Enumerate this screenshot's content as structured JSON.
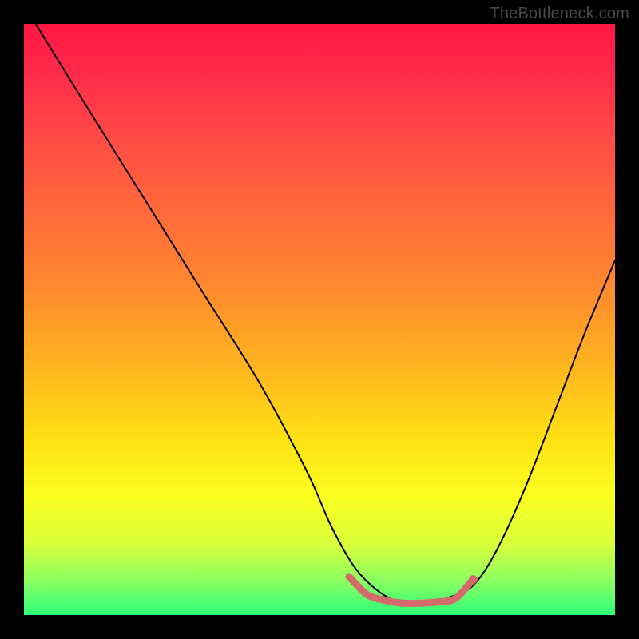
{
  "watermark": "TheBottleneck.com",
  "chart_data": {
    "type": "line",
    "title": "",
    "xlabel": "",
    "ylabel": "",
    "xlim": [
      0,
      100
    ],
    "ylim": [
      0,
      100
    ],
    "grid": false,
    "legend": false,
    "series": [
      {
        "name": "bottleneck-curve",
        "stroke": "#000000",
        "stroke_width": 2,
        "x": [
          2,
          10,
          20,
          30,
          40,
          48,
          52,
          56,
          60,
          64,
          68,
          72,
          76,
          80,
          85,
          90,
          95,
          100
        ],
        "y": [
          100,
          87,
          71,
          55,
          39,
          24,
          15,
          8,
          4,
          2,
          2,
          3,
          5,
          11,
          22,
          35,
          48,
          60
        ]
      },
      {
        "name": "good-range-marker",
        "stroke": "#d46a6a",
        "stroke_width": 9,
        "x": [
          55,
          58,
          61,
          64,
          67,
          70,
          73,
          76
        ],
        "y": [
          6.5,
          3.5,
          2.5,
          2,
          2,
          2.2,
          2.8,
          6
        ]
      }
    ],
    "annotations": []
  },
  "colors": {
    "background_top": "#ff1744",
    "background_bottom": "#2fff7a",
    "curve": "#000000",
    "marker": "#d46a6a",
    "frame": "#000000"
  }
}
